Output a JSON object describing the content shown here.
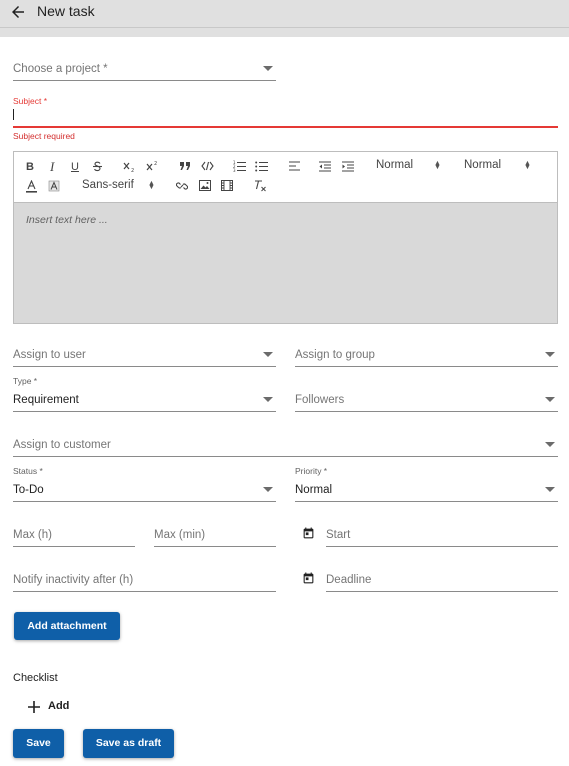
{
  "header": {
    "title": "New task",
    "back_icon": "arrow-left-icon"
  },
  "form": {
    "project": {
      "placeholder": "Choose a project *"
    },
    "subject": {
      "label": "Subject *",
      "error": "Subject required",
      "value": ""
    },
    "editor": {
      "placeholder": "Insert text here ...",
      "toolbar": {
        "bold": "B",
        "italic": "I",
        "underline": "U",
        "header_select": "Normal",
        "size_select": "Normal",
        "font_select": "Sans-serif"
      }
    },
    "assign_user": {
      "placeholder": "Assign to user"
    },
    "assign_group": {
      "placeholder": "Assign to group"
    },
    "type": {
      "label": "Type *",
      "value": "Requirement"
    },
    "followers": {
      "placeholder": "Followers"
    },
    "assign_customer": {
      "placeholder": "Assign to customer"
    },
    "status": {
      "label": "Status *",
      "value": "To-Do"
    },
    "priority": {
      "label": "Priority *",
      "value": "Normal"
    },
    "max_h": {
      "placeholder": "Max (h)"
    },
    "max_min": {
      "placeholder": "Max (min)"
    },
    "start": {
      "placeholder": "Start",
      "icon": "calendar-icon"
    },
    "notify": {
      "placeholder": "Notify inactivity after (h)"
    },
    "deadline": {
      "placeholder": "Deadline",
      "icon": "calendar-icon"
    },
    "add_attachment": "Add attachment",
    "checklist": {
      "label": "Checklist",
      "add_label": "Add"
    },
    "save": "Save",
    "save_draft": "Save as draft"
  },
  "colors": {
    "primary": "#0f5fa8",
    "error": "#e53935",
    "editor_bg": "#d9d9d9",
    "topbar_bg": "#e0e0e0"
  }
}
